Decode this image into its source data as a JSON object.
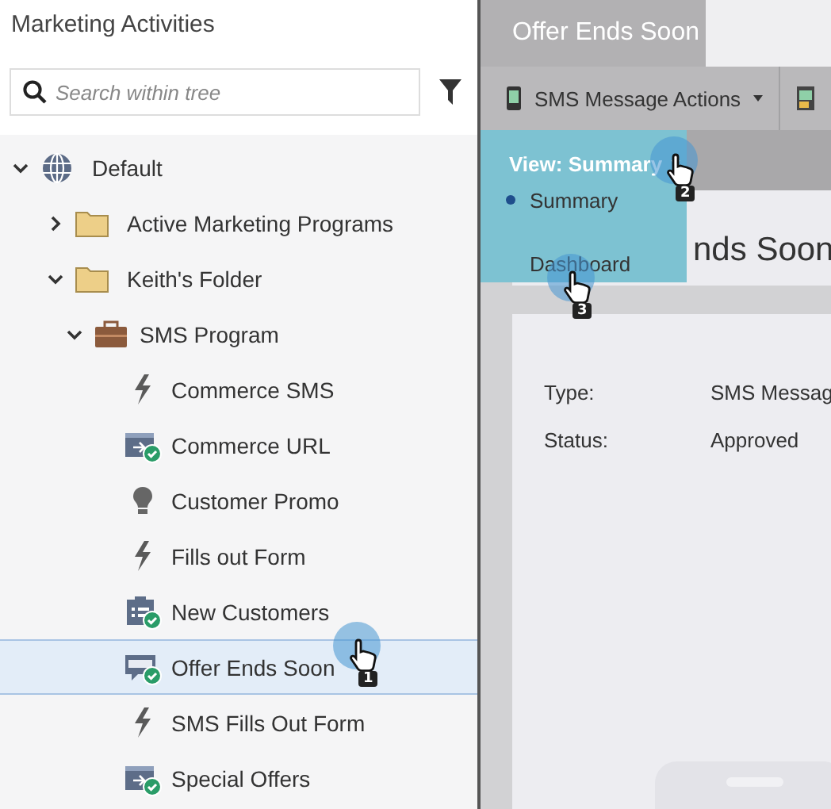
{
  "sidebar": {
    "title": "Marketing Activities",
    "search": {
      "placeholder": "Search within tree"
    },
    "tree": [
      {
        "label": "Default",
        "kind": "globe",
        "expanded": true,
        "selected": false,
        "children": [
          {
            "label": "Active Marketing Programs",
            "kind": "folder",
            "expanded": false,
            "selected": false
          },
          {
            "label": "Keith's Folder",
            "kind": "folder",
            "expanded": true,
            "selected": false,
            "children": [
              {
                "label": "SMS Program",
                "kind": "program",
                "expanded": true,
                "selected": false,
                "children": [
                  {
                    "label": "Commerce SMS",
                    "kind": "trigger",
                    "approved": false,
                    "selected": false
                  },
                  {
                    "label": "Commerce URL",
                    "kind": "landing",
                    "approved": true,
                    "selected": false
                  },
                  {
                    "label": "Customer Promo",
                    "kind": "idea",
                    "approved": false,
                    "selected": false
                  },
                  {
                    "label": "Fills out Form",
                    "kind": "trigger",
                    "approved": false,
                    "selected": false
                  },
                  {
                    "label": "New Customers",
                    "kind": "list",
                    "approved": true,
                    "selected": false
                  },
                  {
                    "label": "Offer Ends Soon",
                    "kind": "sms",
                    "approved": true,
                    "selected": true
                  },
                  {
                    "label": "SMS Fills Out Form",
                    "kind": "trigger",
                    "approved": false,
                    "selected": false
                  },
                  {
                    "label": "Special Offers",
                    "kind": "landing",
                    "approved": true,
                    "selected": false
                  }
                ]
              }
            ]
          }
        ]
      }
    ]
  },
  "tab": {
    "label": "Offer Ends Soon",
    "selected": true
  },
  "toolbar": {
    "actions_label": "SMS Message Actions"
  },
  "view_menu": {
    "label": "View: Summary",
    "options": [
      {
        "label": "Summary",
        "selected": true
      },
      {
        "label": "Dashboard",
        "selected": false
      }
    ]
  },
  "heading": "nds Soon",
  "details": [
    {
      "label": "Type:",
      "value": "SMS Messag"
    },
    {
      "label": "Status:",
      "value": "Approved"
    }
  ],
  "callouts": [
    {
      "number": "1"
    },
    {
      "number": "2"
    },
    {
      "number": "3"
    }
  ]
}
